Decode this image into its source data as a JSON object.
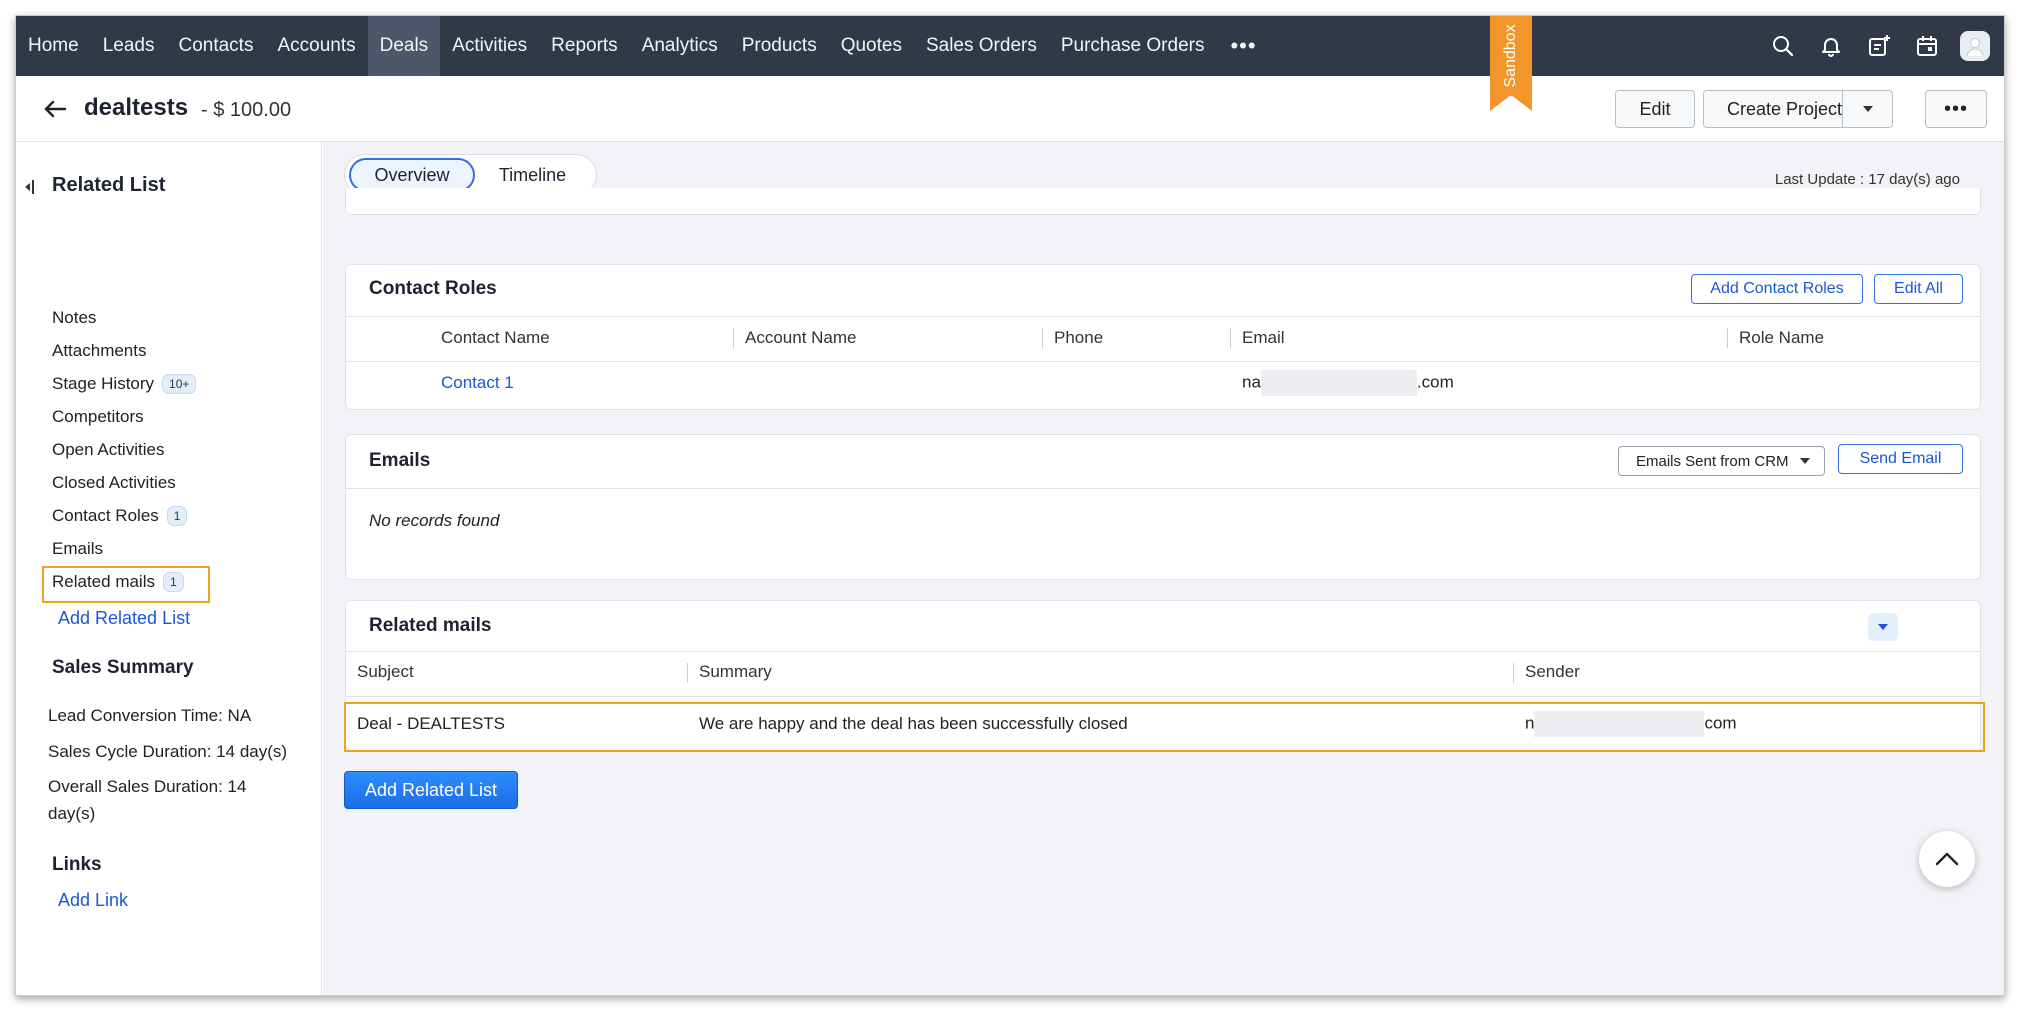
{
  "topnav": {
    "items": [
      "Home",
      "Leads",
      "Contacts",
      "Accounts",
      "Deals",
      "Activities",
      "Reports",
      "Analytics",
      "Products",
      "Quotes",
      "Sales Orders",
      "Purchase Orders"
    ],
    "more": "•••",
    "sandbox": "Sandbox",
    "active": "Deals"
  },
  "record": {
    "title": "dealtests",
    "amount": "- $ 100.00",
    "edit_label": "Edit",
    "create_project_label": "Create Project",
    "more_label": "•••"
  },
  "sidebar": {
    "heading": "Related List",
    "items": [
      {
        "label": "Notes"
      },
      {
        "label": "Attachments"
      },
      {
        "label": "Stage History",
        "badge": "10+"
      },
      {
        "label": "Competitors"
      },
      {
        "label": "Open Activities"
      },
      {
        "label": "Closed Activities"
      },
      {
        "label": "Contact Roles",
        "badge": "1"
      },
      {
        "label": "Emails"
      },
      {
        "label": "Related mails",
        "badge": "1"
      }
    ],
    "add_related_list": "Add Related List",
    "sales_summary_heading": "Sales Summary",
    "lead_conversion": "Lead Conversion Time: NA",
    "sales_cycle": "Sales Cycle Duration: 14 day(s)",
    "overall_sales": "Overall Sales Duration: 14 day(s)",
    "links_heading": "Links",
    "add_link": "Add Link"
  },
  "main": {
    "tabs": {
      "overview": "Overview",
      "timeline": "Timeline"
    },
    "last_update": "Last Update : 17 day(s) ago",
    "contact_roles": {
      "title": "Contact Roles",
      "add_button": "Add Contact Roles",
      "edit_all_button": "Edit All",
      "columns": [
        "Contact Name",
        "Account Name",
        "Phone",
        "Email",
        "Role Name"
      ],
      "row": {
        "contact_name": "Contact 1",
        "email_prefix": "na",
        "email_suffix": ".com"
      }
    },
    "emails": {
      "title": "Emails",
      "filter": "Emails Sent from CRM",
      "send_button": "Send Email",
      "empty": "No records found"
    },
    "related_mails": {
      "title": "Related mails",
      "columns": [
        "Subject",
        "Summary",
        "Sender"
      ],
      "row": {
        "subject": "Deal - DEALTESTS",
        "summary": "We are happy and the deal has been successfully closed",
        "sender_prefix": "n",
        "sender_suffix": "com"
      }
    },
    "add_related_list_button": "Add Related List"
  },
  "colors": {
    "nav_bg": "#313949",
    "accent": "#1a56d9",
    "highlight": "#e8a423",
    "sandbox": "#f2952a"
  }
}
